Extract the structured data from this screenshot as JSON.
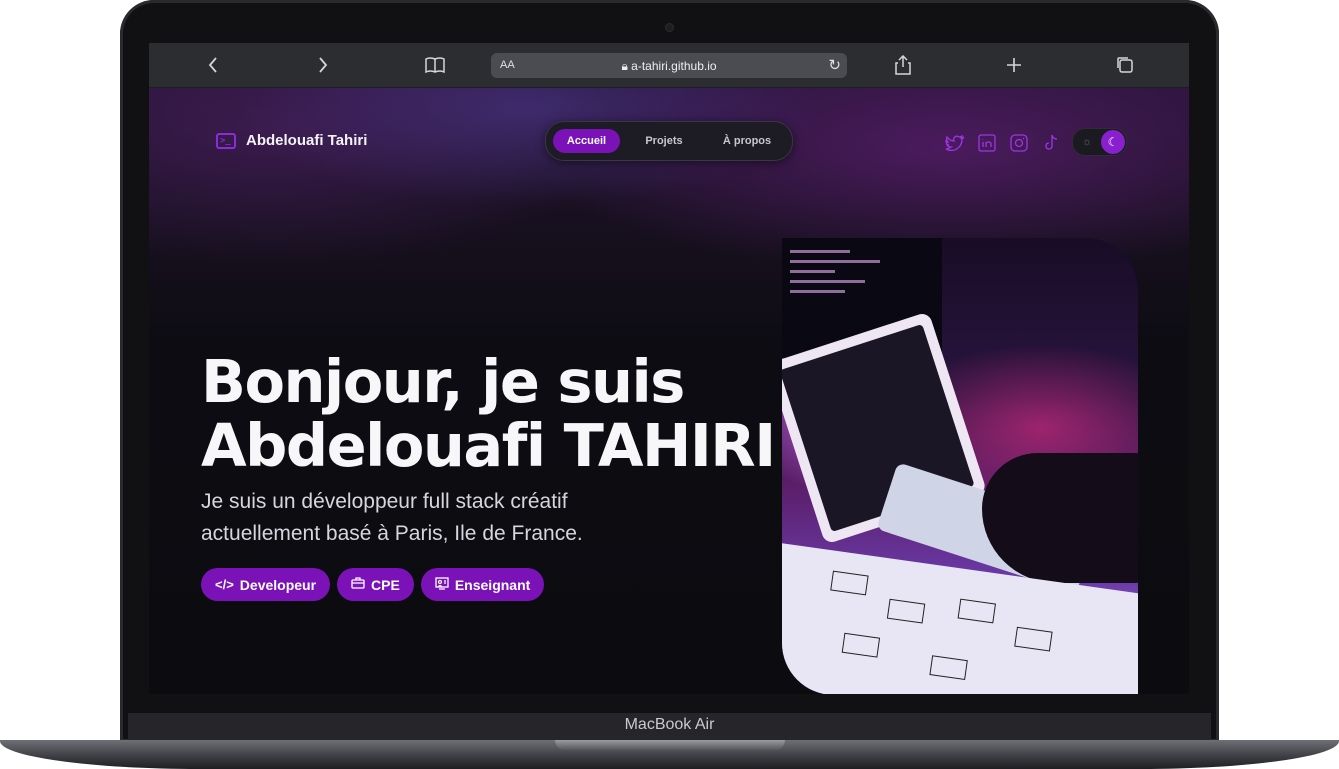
{
  "device": {
    "label": "MacBook Air"
  },
  "browser": {
    "url_text_size_label": "AA",
    "url": "a-tahiri.github.io",
    "icons": [
      "chevron-left-icon",
      "chevron-right-icon",
      "book-icon",
      "lock-icon",
      "reload-icon",
      "share-icon",
      "plus-icon",
      "tabs-icon"
    ]
  },
  "site": {
    "brand_name": "Abdelouafi Tahiri",
    "nav": [
      {
        "label": "Accueil",
        "active": true
      },
      {
        "label": "Projets",
        "active": false
      },
      {
        "label": "À propos",
        "active": false
      }
    ],
    "socials": [
      "twitter-icon",
      "linkedin-icon",
      "instagram-icon",
      "tiktok-icon"
    ],
    "theme": "dark",
    "hero": {
      "title_line1": "Bonjour, je suis",
      "title_line2": "Abdelouafi TAHIRI",
      "subtitle_line1": "Je suis un développeur full stack créatif",
      "subtitle_line2": "actuellement basé à Paris, Ile de France."
    },
    "tags": [
      {
        "label": "Developeur",
        "icon": "code-icon"
      },
      {
        "label": "CPE",
        "icon": "briefcase-icon"
      },
      {
        "label": "Enseignant",
        "icon": "teacher-icon"
      }
    ]
  },
  "colors": {
    "accent": "#7b12b8",
    "background": "#0c0c11"
  }
}
